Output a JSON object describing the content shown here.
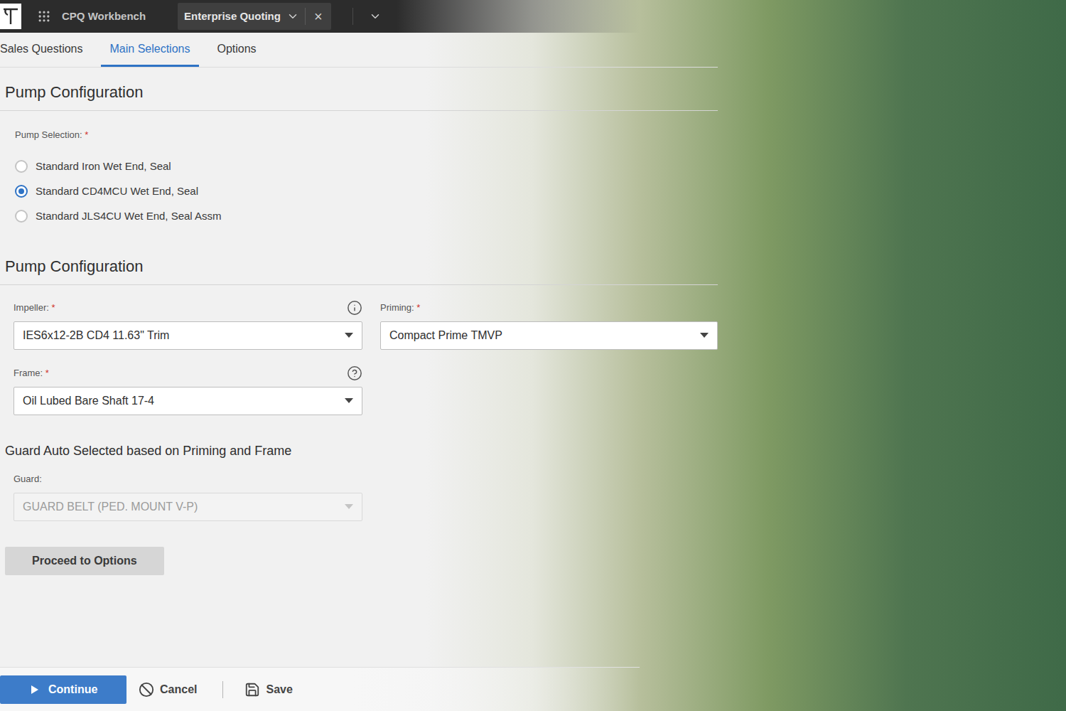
{
  "app_bar": {
    "product": "CPQ Workbench",
    "tab": {
      "label": "Enterprise Quoting",
      "close": "×"
    }
  },
  "tabs": [
    {
      "label": "Sales Questions",
      "selected": false
    },
    {
      "label": "Main Selections",
      "selected": true
    },
    {
      "label": "Options",
      "selected": false
    }
  ],
  "pump_selection": {
    "heading": "Pump Configuration",
    "label": "Pump Selection:",
    "required": "*",
    "options": [
      {
        "label": "Standard Iron Wet End, Seal",
        "selected": false
      },
      {
        "label": "Standard CD4MCU Wet End, Seal",
        "selected": true
      },
      {
        "label": "Standard JLS4CU Wet End, Seal Assm",
        "selected": false
      }
    ]
  },
  "pump_configuration": {
    "heading": "Pump Configuration",
    "impeller": {
      "label": "Impeller:",
      "required": "*",
      "value": "IES6x12-2B CD4 11.63\" Trim"
    },
    "priming": {
      "label": "Priming:",
      "required": "*",
      "value": "Compact Prime TMVP"
    },
    "frame": {
      "label": "Frame:",
      "required": "*",
      "value": "Oil Lubed Bare Shaft 17-4"
    }
  },
  "guard": {
    "heading": "Guard Auto Selected based on Priming and Frame",
    "label": "Guard:",
    "value": "GUARD BELT (PED. MOUNT V-P)",
    "disabled": true
  },
  "proceed_button": "Proceed to Options",
  "footer": {
    "continue": "Continue",
    "cancel": "Cancel",
    "save": "Save"
  }
}
